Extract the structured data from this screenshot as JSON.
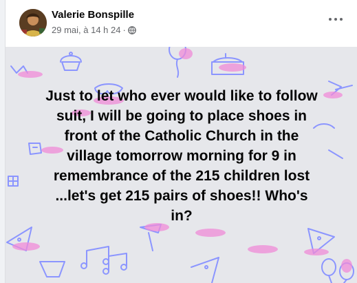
{
  "post": {
    "author": "Valerie Bonspille",
    "timestamp": "29 mai, à 14 h 24",
    "separator": "·",
    "privacy_icon": "globe-icon",
    "menu_icon": "more-options-icon",
    "text": "Just to let who ever would like to follow\nsuit, I will be going to place shoes in\nfront of the Catholic Church in the\nvillage tomorrow morning for 9 in\nremembrance of the 215 children lost\n...let's get 215 pairs of shoes!! Who's\nin?",
    "background_theme": "party-doodles",
    "colors": {
      "text": "#050505",
      "meta": "#65676b",
      "background": "#e6e7eb",
      "doodle_blue": "#8b95ff",
      "doodle_pink": "#f08bd8"
    }
  }
}
